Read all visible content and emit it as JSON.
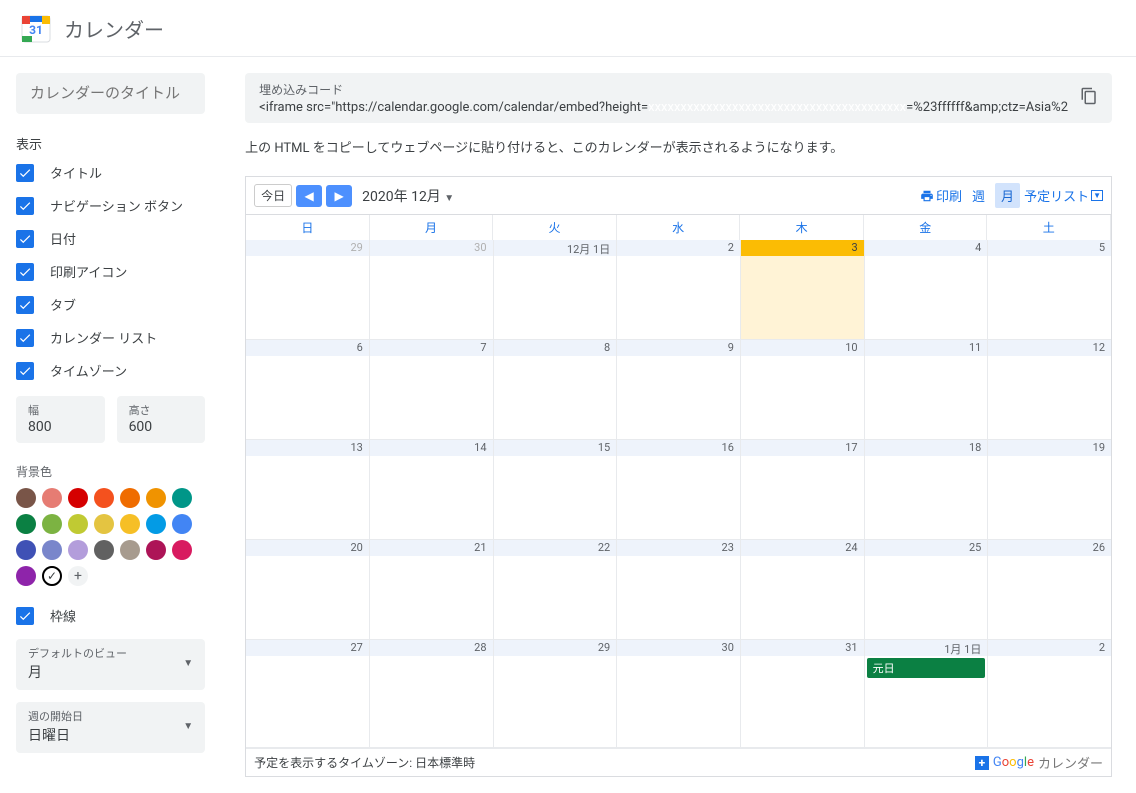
{
  "header": {
    "title": "カレンダー"
  },
  "sidebar": {
    "title_placeholder": "カレンダーのタイトル",
    "display_label": "表示",
    "checkboxes": [
      "タイトル",
      "ナビゲーション ボタン",
      "日付",
      "印刷アイコン",
      "タブ",
      "カレンダー リスト",
      "タイムゾーン"
    ],
    "width_label": "幅",
    "width_value": "800",
    "height_label": "高さ",
    "height_value": "600",
    "bg_label": "背景色",
    "colors": [
      "#795548",
      "#e67c73",
      "#d50000",
      "#f4511e",
      "#ef6c00",
      "#f09300",
      "#009688",
      "#0b8043",
      "#7cb342",
      "#c0ca33",
      "#e4c441",
      "#f6bf26",
      "#039be5",
      "#4285f4",
      "#3f51b5",
      "#7986cb",
      "#b39ddb",
      "#616161",
      "#a79b8e",
      "#ad1457",
      "#d81b60",
      "#8e24aa"
    ],
    "border_label": "枠線",
    "default_view_label": "デフォルトのビュー",
    "default_view_value": "月",
    "week_start_label": "週の開始日",
    "week_start_value": "日曜日"
  },
  "embed": {
    "label": "埋め込みコード",
    "code_part1": "<iframe src=\"https://calendar.google.com/calendar/embed?height=",
    "code_part2": "=%23ffffff&amp;ctz=Asia%2",
    "help": "上の HTML をコピーしてウェブページに貼り付けると、このカレンダーが表示されるようになります。"
  },
  "preview": {
    "today_btn": "今日",
    "month_title": "2020年 12月",
    "print_label": "印刷",
    "view_week": "週",
    "view_month": "月",
    "view_agenda": "予定リスト",
    "day_names": [
      "日",
      "月",
      "火",
      "水",
      "木",
      "金",
      "土"
    ],
    "weeks": [
      [
        {
          "d": "29",
          "m": true
        },
        {
          "d": "30",
          "m": true
        },
        {
          "d": "12月 1日"
        },
        {
          "d": "2"
        },
        {
          "d": "3",
          "today": true
        },
        {
          "d": "4"
        },
        {
          "d": "5"
        }
      ],
      [
        {
          "d": "6"
        },
        {
          "d": "7"
        },
        {
          "d": "8"
        },
        {
          "d": "9"
        },
        {
          "d": "10"
        },
        {
          "d": "11"
        },
        {
          "d": "12"
        }
      ],
      [
        {
          "d": "13"
        },
        {
          "d": "14"
        },
        {
          "d": "15"
        },
        {
          "d": "16"
        },
        {
          "d": "17"
        },
        {
          "d": "18"
        },
        {
          "d": "19"
        }
      ],
      [
        {
          "d": "20"
        },
        {
          "d": "21"
        },
        {
          "d": "22"
        },
        {
          "d": "23"
        },
        {
          "d": "24"
        },
        {
          "d": "25"
        },
        {
          "d": "26"
        }
      ],
      [
        {
          "d": "27"
        },
        {
          "d": "28"
        },
        {
          "d": "29"
        },
        {
          "d": "30"
        },
        {
          "d": "31"
        },
        {
          "d": "1月 1日",
          "event": "元日"
        },
        {
          "d": "2"
        }
      ]
    ],
    "tz_text": "予定を表示するタイムゾーン: 日本標準時",
    "brand_suffix": "カレンダー"
  }
}
